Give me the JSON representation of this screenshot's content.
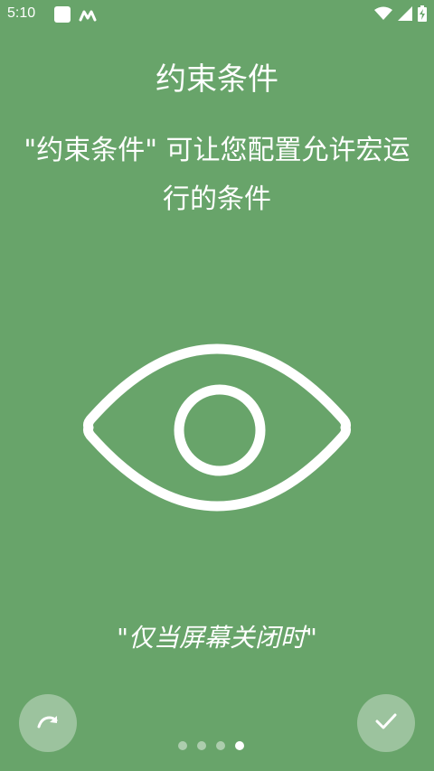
{
  "status_bar": {
    "time": "5:10"
  },
  "onboarding": {
    "title": "约束条件",
    "description": "\"约束条件\" 可让您配置允许宏运行的条件",
    "example_quote": "\"仅当屏幕关闭时\"",
    "illustration_icon": "eye-icon",
    "page_count": 4,
    "current_page": 4
  },
  "colors": {
    "background": "#68a46a",
    "foreground": "#ffffff"
  }
}
